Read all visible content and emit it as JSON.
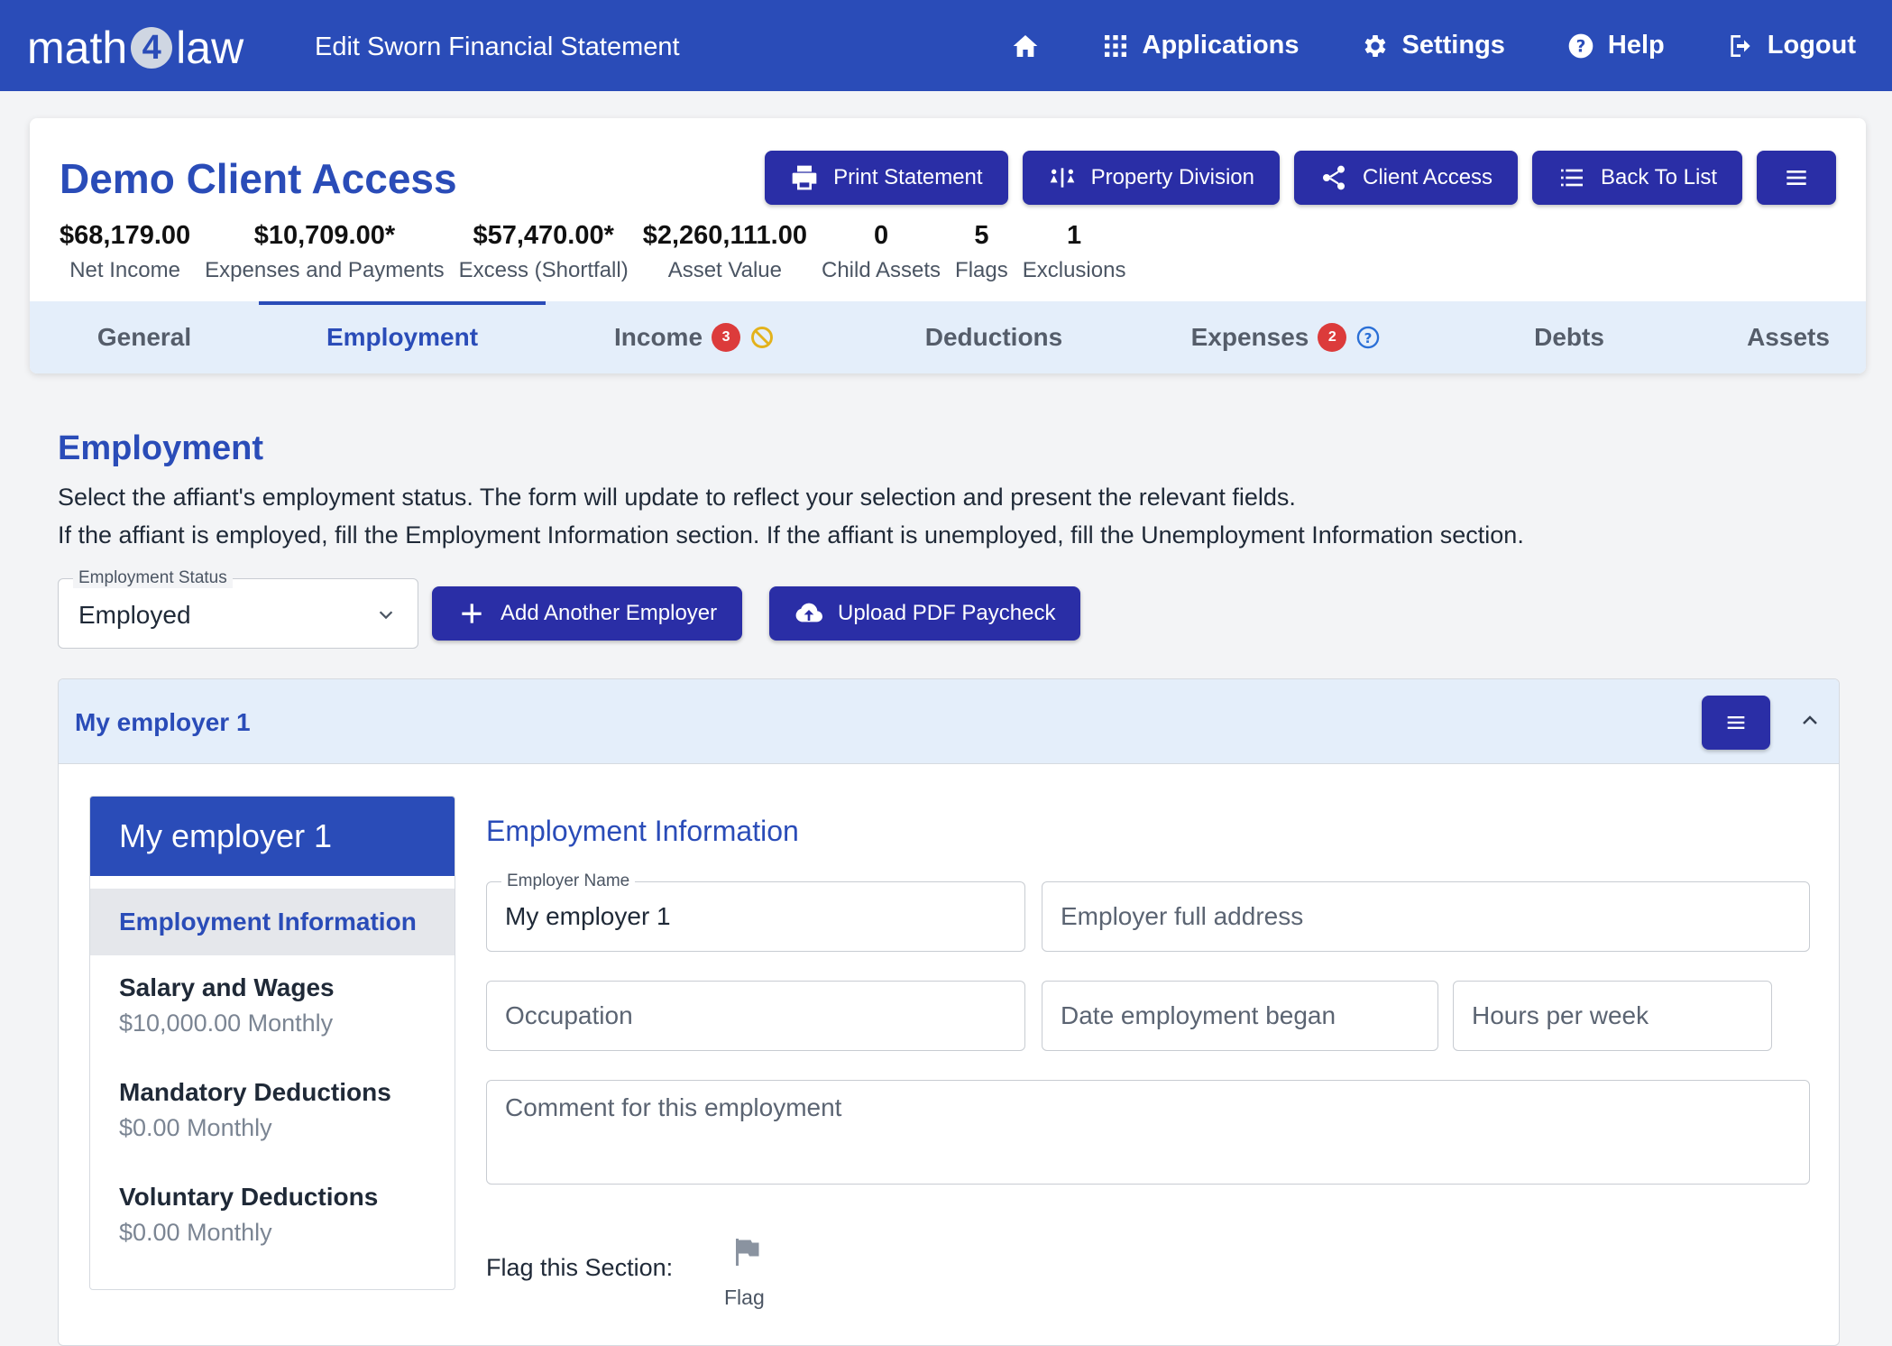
{
  "app": {
    "logo_left": "math",
    "logo_mid": "4",
    "logo_right": "law",
    "page_title": "Edit Sworn Financial Statement"
  },
  "nav": {
    "applications": "Applications",
    "settings": "Settings",
    "help": "Help",
    "logout": "Logout"
  },
  "client": {
    "name": "Demo Client Access",
    "actions": {
      "print": "Print Statement",
      "property": "Property Division",
      "access": "Client Access",
      "back": "Back To List"
    },
    "stats": [
      {
        "value": "$68,179.00",
        "label": "Net Income"
      },
      {
        "value": "$10,709.00*",
        "label": "Expenses and Payments"
      },
      {
        "value": "$57,470.00*",
        "label": "Excess (Shortfall)"
      },
      {
        "value": "$2,260,111.00",
        "label": "Asset Value"
      },
      {
        "value": "0",
        "label": "Child Assets"
      },
      {
        "value": "5",
        "label": "Flags"
      },
      {
        "value": "1",
        "label": "Exclusions"
      }
    ]
  },
  "tabs": {
    "general": "General",
    "employment": "Employment",
    "income": "Income",
    "income_badge": "3",
    "deductions": "Deductions",
    "expenses": "Expenses",
    "expenses_badge": "2",
    "debts": "Debts",
    "assets": "Assets"
  },
  "section": {
    "title": "Employment",
    "desc1": "Select the affiant's employment status. The form will update to reflect your selection and present the relevant fields.",
    "desc2": "If the affiant is employed, fill the Employment Information section. If the affiant is unemployed, fill the Unemployment Information section.",
    "status_label": "Employment Status",
    "status_value": "Employed",
    "add_employer": "Add Another Employer",
    "upload_paycheck": "Upload PDF Paycheck"
  },
  "employer": {
    "accordion_title": "My employer 1",
    "side_title": "My employer 1",
    "side_items": [
      {
        "title": "Employment Information"
      },
      {
        "title": "Salary and Wages",
        "sub": "$10,000.00 Monthly"
      },
      {
        "title": "Mandatory Deductions",
        "sub": "$0.00 Monthly"
      },
      {
        "title": "Voluntary Deductions",
        "sub": "$0.00 Monthly"
      }
    ],
    "form_title": "Employment Information",
    "employer_name_label": "Employer Name",
    "employer_name_value": "My employer 1",
    "address_ph": "Employer full address",
    "occupation_ph": "Occupation",
    "date_ph": "Date employment began",
    "hours_ph": "Hours per week",
    "comment_ph": "Comment for this employment",
    "flag_label": "Flag this Section:",
    "flag_text": "Flag"
  },
  "colors": {
    "brand": "#2a4cb8",
    "button": "#2a2ea6",
    "badge": "#dc3b3b",
    "tab_bg": "#e4eefa"
  }
}
